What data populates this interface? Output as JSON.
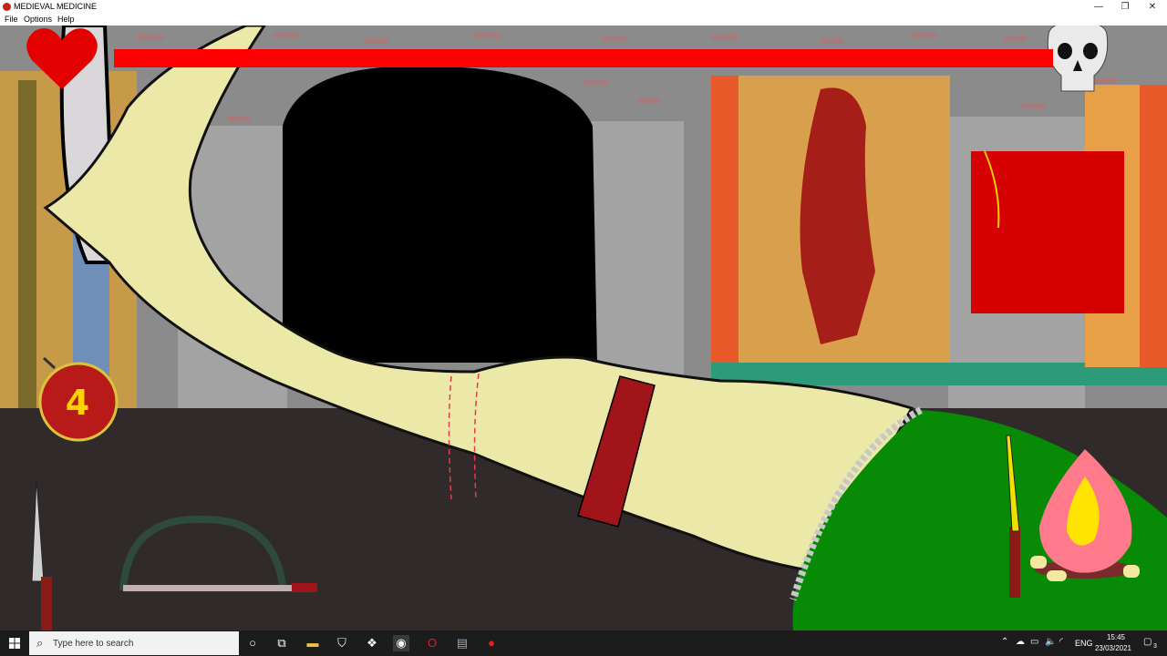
{
  "window": {
    "title": "MEDIEVAL MEDICINE",
    "minimize_glyph": "—",
    "restore_glyph": "❐",
    "close_glyph": "✕"
  },
  "menu": {
    "items": [
      "File",
      "Options",
      "Help"
    ]
  },
  "hud": {
    "health_fraction": 1.0,
    "health_color": "#ff0000",
    "bomb_count": "4",
    "heart_icon": "heart-icon",
    "skull_icon": "skull-icon"
  },
  "scene": {
    "tools": [
      "knife",
      "bow-saw",
      "torch",
      "campfire",
      "bone-saw",
      "hanging-cleaver"
    ],
    "patient_limb": "leg with red tourniquet strap",
    "tourniquet_color": "#a0141a",
    "grass_color": "#078a05"
  },
  "taskbar": {
    "search_placeholder": "Type here to search",
    "lang": "ENG",
    "time": "15:45",
    "date": "23/03/2021",
    "notification_count": "3"
  }
}
